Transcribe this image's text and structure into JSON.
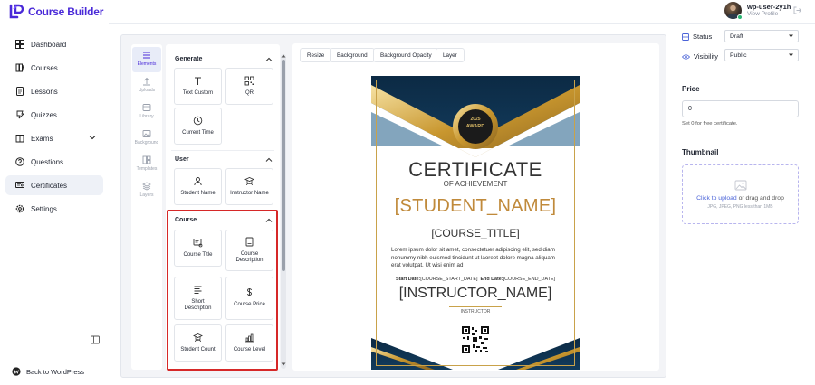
{
  "app": {
    "name": "Course Builder",
    "brand_color": "#4a2ad8"
  },
  "user": {
    "name": "wp-user-2y1h",
    "sub": "View Profile"
  },
  "sidebar": {
    "items": [
      {
        "label": "Dashboard",
        "icon": "dashboard-icon"
      },
      {
        "label": "Courses",
        "icon": "courses-icon"
      },
      {
        "label": "Lessons",
        "icon": "lessons-icon"
      },
      {
        "label": "Quizzes",
        "icon": "quizzes-icon"
      },
      {
        "label": "Exams",
        "icon": "exams-icon"
      },
      {
        "label": "Questions",
        "icon": "questions-icon"
      },
      {
        "label": "Certificates",
        "icon": "certificates-icon",
        "active": true
      },
      {
        "label": "Settings",
        "icon": "settings-icon"
      }
    ],
    "back_label": "Back to WordPress"
  },
  "tools": [
    {
      "label": "Elements",
      "active": true
    },
    {
      "label": "Uploads"
    },
    {
      "label": "Library"
    },
    {
      "label": "Background"
    },
    {
      "label": "Templates"
    },
    {
      "label": "Layers"
    }
  ],
  "elements_panel": {
    "generate": {
      "title": "Generate",
      "items": [
        "Text Custom",
        "QR",
        "Current Time"
      ]
    },
    "user": {
      "title": "User",
      "items": [
        "Student Name",
        "Instructor Name"
      ]
    },
    "course": {
      "title": "Course",
      "items": [
        "Course Title",
        "Course Description",
        "Short Description",
        "Course Price",
        "Student Count",
        "Course Level"
      ]
    }
  },
  "toolbar": [
    "Resize",
    "Background",
    "Background Opacity",
    "Layer"
  ],
  "certificate": {
    "badge_year": "2025",
    "badge_text": "AWARD",
    "title": "CERTIFICATE",
    "subtitle": "OF ACHIEVEMENT",
    "student": "[STUDENT_NAME]",
    "course": "[COURSE_TITLE]",
    "body": "Lorem ipsum dolor sit amet, consectetuer adipiscing elit, sed diam nonummy nibh euismod tincidunt ut laoreet dolore magna aliquam erat volutpat. Ut wisi enim ad",
    "start_label": "Start Date:",
    "start_value": "[COURSE_START_DATE]",
    "end_label": "End Date:",
    "end_value": "[COURSE_END_DATE]",
    "instructor": "[INSTRUCTOR_NAME]",
    "instructor_label": "INSTRUCTOR"
  },
  "right_panel": {
    "status_label": "Status",
    "status_value": "Draft",
    "visibility_label": "Visibility",
    "visibility_value": "Public",
    "price_title": "Price",
    "price_value": "0",
    "price_help": "Set 0 for free certificate.",
    "thumbnail_title": "Thumbnail",
    "upload_link": "Click to upload",
    "upload_rest": " or drag and drop",
    "upload_hint": "JPG, JPEG, PNG less than 1MB"
  }
}
